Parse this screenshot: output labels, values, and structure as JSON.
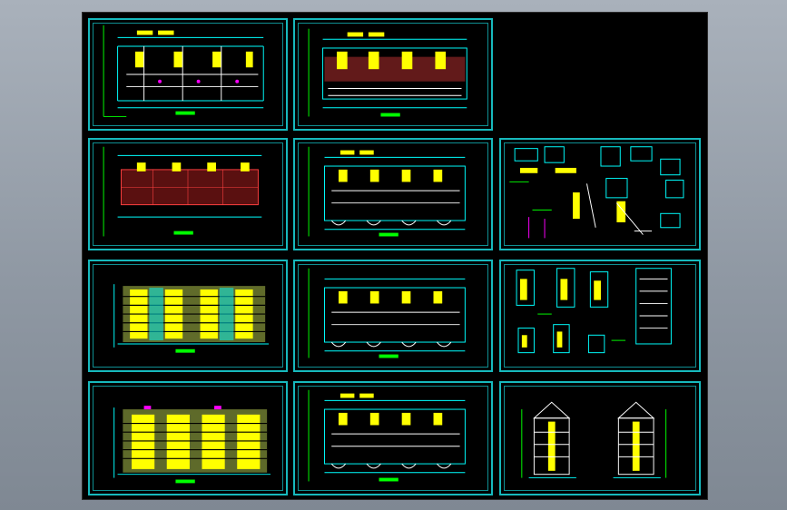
{
  "viewer": {
    "background_color": "#000000",
    "frame_color": "#17b9bd",
    "accent_colors": [
      "#00ffff",
      "#ffff00",
      "#00ff00",
      "#ff4040",
      "#ffffff",
      "#ff00ff"
    ]
  },
  "sheets": [
    {
      "id": "s1",
      "kind": "floor-plan"
    },
    {
      "id": "s2",
      "kind": "floor-plan-shaded"
    },
    {
      "id": "s3",
      "kind": "roof-plan"
    },
    {
      "id": "s4",
      "kind": "floor-plan"
    },
    {
      "id": "s5",
      "kind": "details"
    },
    {
      "id": "s6",
      "kind": "elevation-front"
    },
    {
      "id": "s7",
      "kind": "floor-plan"
    },
    {
      "id": "s8",
      "kind": "section-details"
    },
    {
      "id": "s9",
      "kind": "elevation-rear"
    },
    {
      "id": "s10",
      "kind": "floor-plan"
    },
    {
      "id": "s11",
      "kind": "side-elevations"
    }
  ]
}
